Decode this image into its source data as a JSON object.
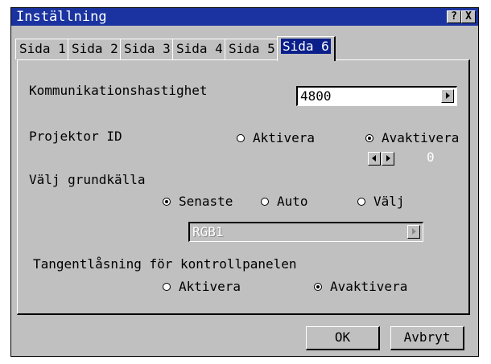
{
  "window": {
    "title": "Inställning",
    "help_button": "?",
    "close_button": "X"
  },
  "tabs": [
    {
      "label": "Sida 1"
    },
    {
      "label": "Sida 2"
    },
    {
      "label": "Sida 3"
    },
    {
      "label": "Sida 4"
    },
    {
      "label": "Sida 5"
    },
    {
      "label": "Sida 6",
      "active": true
    }
  ],
  "comm_speed": {
    "label": "Kommunikationshastighet",
    "value": "4800"
  },
  "projector_id": {
    "label": "Projektor ID",
    "options": [
      "Aktivera",
      "Avaktivera"
    ],
    "selected": "Avaktivera",
    "spin_value": "0"
  },
  "default_source": {
    "label": "Välj grundkälla",
    "options": [
      "Senaste",
      "Auto",
      "Välj"
    ],
    "selected": "Senaste",
    "select_value": "RGB1"
  },
  "key_lock": {
    "label": "Tangentlåsning för kontrollpanelen",
    "options": [
      "Aktivera",
      "Avaktivera"
    ],
    "selected": "Avaktivera"
  },
  "buttons": {
    "ok": "OK",
    "cancel": "Avbryt"
  }
}
